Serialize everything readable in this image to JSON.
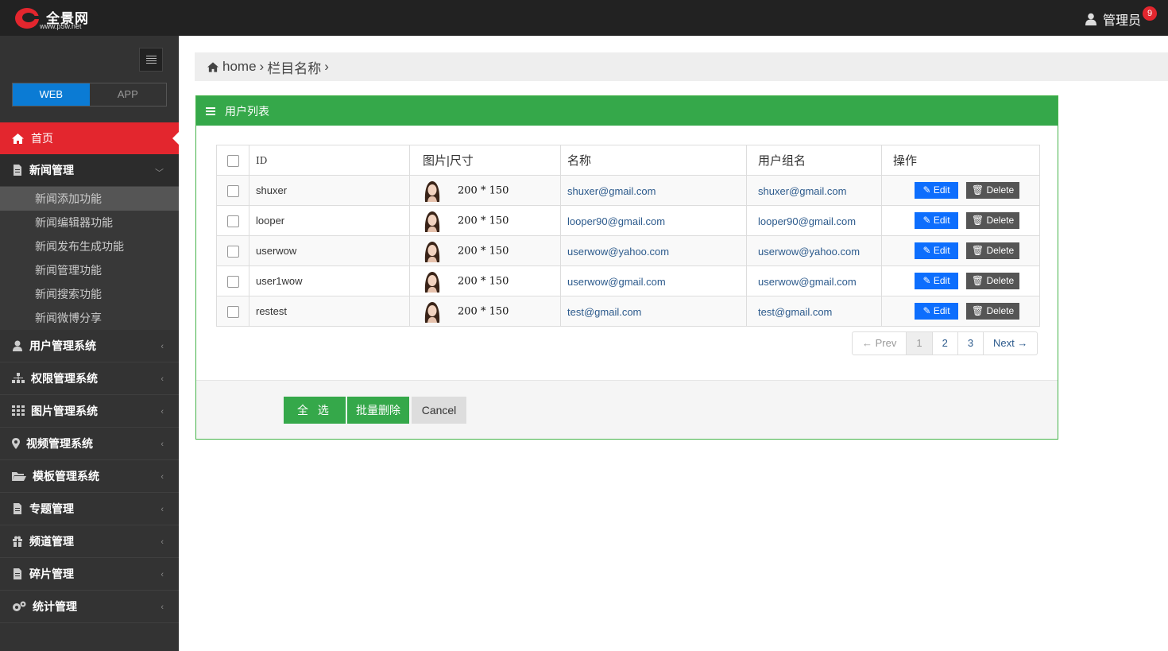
{
  "header": {
    "logo_title": "全景网",
    "logo_url": "www.p5w.net",
    "user_name": "管理员",
    "notification_count": "9"
  },
  "sidebar": {
    "tabs": [
      {
        "label": "WEB",
        "active": true
      },
      {
        "label": "APP",
        "active": false
      }
    ],
    "home": "首页",
    "news": {
      "label": "新闻管理",
      "items": [
        "新闻添加功能",
        "新闻编辑器功能",
        "新闻发布生成功能",
        "新闻管理功能",
        "新闻搜索功能",
        "新闻微博分享"
      ]
    },
    "menu": [
      {
        "label": "用户管理系统",
        "icon": "user-icon"
      },
      {
        "label": "权限管理系统",
        "icon": "sitemap-icon"
      },
      {
        "label": "图片管理系统",
        "icon": "grid-icon"
      },
      {
        "label": "视频管理系统",
        "icon": "map-marker-icon"
      },
      {
        "label": "模板管理系统",
        "icon": "folder-icon"
      },
      {
        "label": "专题管理",
        "icon": "file-icon"
      },
      {
        "label": "频道管理",
        "icon": "gift-icon"
      },
      {
        "label": "碎片管理",
        "icon": "file-icon"
      },
      {
        "label": "统计管理",
        "icon": "cogs-icon"
      }
    ]
  },
  "breadcrumb": {
    "home": "home",
    "sep1": "›",
    "current": "栏目名称",
    "sep2": "›"
  },
  "panel": {
    "title": "用户列表",
    "columns": [
      "ID",
      "图片|尺寸",
      "名称",
      "用户组名",
      "操作"
    ],
    "rows": [
      {
        "id": "shuxer",
        "size": "200 * 150",
        "name": "shuxer@gmail.com",
        "group": "shuxer@gmail.com"
      },
      {
        "id": "looper",
        "size": "200 * 150",
        "name": "looper90@gmail.com",
        "group": "looper90@gmail.com"
      },
      {
        "id": "userwow",
        "size": "200 * 150",
        "name": "userwow@yahoo.com",
        "group": "userwow@yahoo.com"
      },
      {
        "id": "user1wow",
        "size": "200 * 150",
        "name": "userwow@gmail.com",
        "group": "userwow@gmail.com"
      },
      {
        "id": "restest",
        "size": "200 * 150",
        "name": "test@gmail.com",
        "group": "test@gmail.com"
      }
    ],
    "edit_label": "Edit",
    "delete_label": "Delete",
    "pager": {
      "prev": "← Prev",
      "pages": [
        "1",
        "2",
        "3"
      ],
      "next": "Next →",
      "current": "1"
    },
    "footer": {
      "select_all": "全 选",
      "batch_delete": "批量删除",
      "cancel": "Cancel"
    }
  },
  "colors": {
    "topbar": "#222222",
    "sidebar": "#333333",
    "home_active": "#e3262e",
    "tab_active": "#0b7bd4",
    "panel_head": "#35a84a",
    "edit_button": "#0d6efd",
    "delete_button": "#555555"
  }
}
